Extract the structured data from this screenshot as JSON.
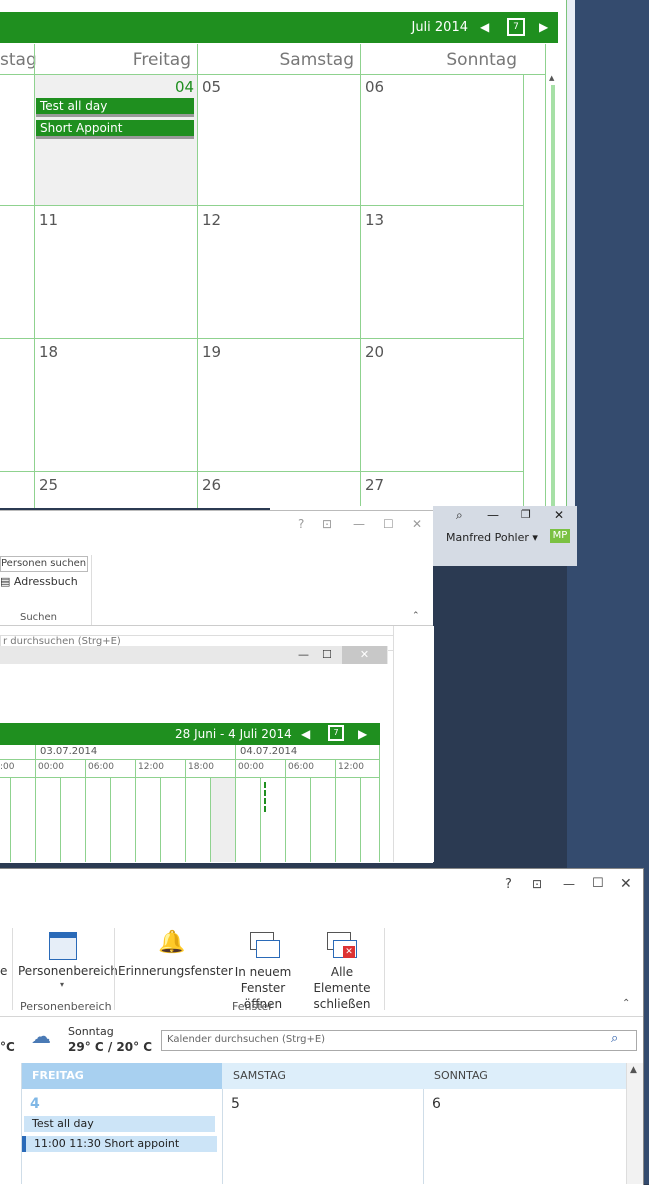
{
  "month_window": {
    "title": "Juli 2014",
    "day_names": [
      "stag",
      "Freitag",
      "Samstag",
      "Sonntag"
    ],
    "rows": [
      [
        "04",
        "05",
        "06"
      ],
      [
        "11",
        "12",
        "13"
      ],
      [
        "18",
        "19",
        "20"
      ],
      [
        "25",
        "26",
        "27"
      ]
    ],
    "events": [
      "Test all day",
      "Short Appoint"
    ]
  },
  "mid_window": {
    "user_name": "Manfred Pohler",
    "avatar": "MP",
    "search_group": "Personen suchen",
    "address_book": "Adressbuch",
    "group_label": "Suchen",
    "search_placeholder": "r durchsuchen (Strg+E)"
  },
  "week_window": {
    "range": "28 Juni - 4 Juli 2014",
    "dates": [
      "03.07.2014",
      "04.07.2014"
    ],
    "times": [
      ":00",
      "00:00",
      "06:00",
      "12:00",
      "18:00",
      "00:00",
      "06:00",
      "12:00"
    ]
  },
  "bottom_window": {
    "ribbon": {
      "e_label": "e",
      "people_pane": "Personenbereich",
      "people_group": "Personenbereich",
      "reminders": "Erinnerungsfenster",
      "open_new": "In neuem Fenster öffnen",
      "close_all": "Alle Elemente schließen",
      "window_group": "Fenster"
    },
    "weather": {
      "left_temp": "°C",
      "day": "Sonntag",
      "temps": "29° C / 20° C"
    },
    "search_placeholder": "Kalender durchsuchen (Strg+E)",
    "columns": [
      "FREITAG",
      "SAMSTAG",
      "SONNTAG"
    ],
    "numbers": [
      "4",
      "5",
      "6"
    ],
    "events": [
      "Test all day",
      "11:00 11:30 Short appoint"
    ]
  }
}
